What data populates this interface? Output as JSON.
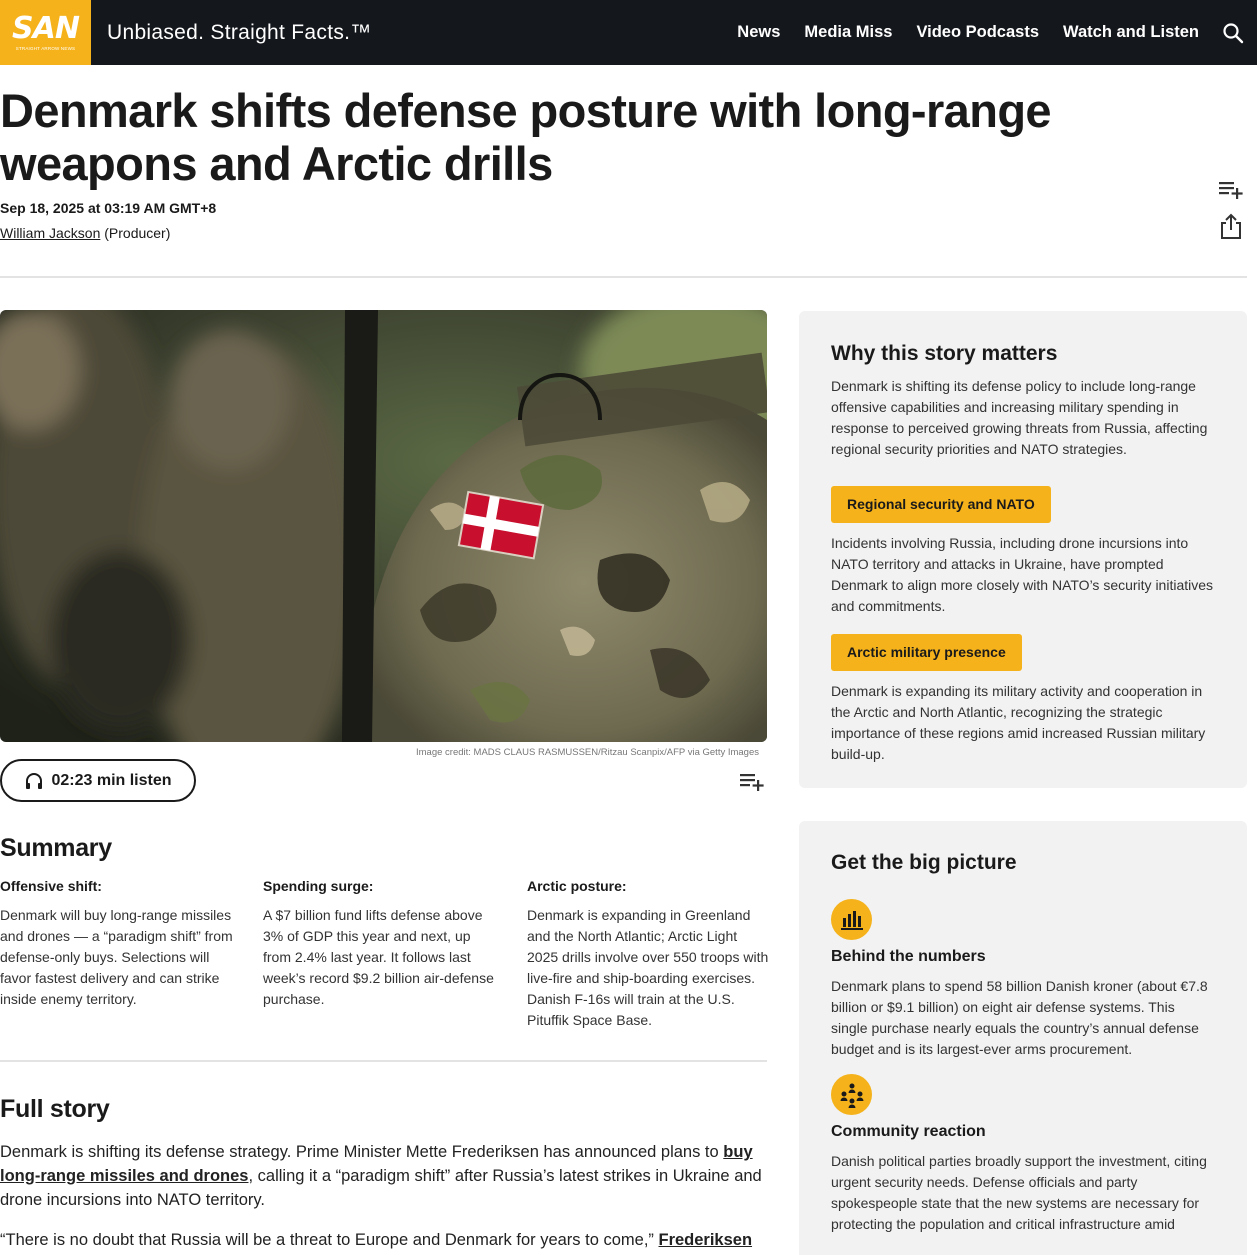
{
  "header": {
    "logo_text": "SAN",
    "logo_subtext": "STRAIGHT ARROW NEWS",
    "tagline": "Unbiased. Straight Facts.™",
    "nav": [
      "News",
      "Media Miss",
      "Video Podcasts",
      "Watch and Listen"
    ],
    "brand_color": "#f5b21a"
  },
  "article": {
    "headline": "Denmark shifts defense posture with long-range weapons and Arctic drills",
    "date": "Sep 18, 2025 at 03:19 AM GMT+8",
    "author": "William Jackson",
    "author_role": "(Producer)",
    "image_credit": "Image credit: MADS CLAUS RASMUSSEN/Ritzau Scanpix/AFP via Getty Images",
    "listen_label": "02:23 min listen"
  },
  "summary": {
    "heading": "Summary",
    "items": [
      {
        "title": "Offensive shift:",
        "text": "Denmark will buy long-range missiles and drones — a “paradigm shift” from defense-only buys. Selections will favor fastest delivery and can strike inside enemy territory."
      },
      {
        "title": "Spending surge:",
        "text": "A $7 billion fund lifts defense above 3% of GDP this year and next, up from 2.4% last year. It follows last week’s record $9.2 billion air-defense purchase."
      },
      {
        "title": "Arctic posture:",
        "text": "Denmark is expanding in Greenland and the North Atlantic; Arctic Light 2025 drills involve over 550 troops with live-fire and ship-boarding exercises. Danish F-16s will train at the U.S. Pituffik Space Base."
      }
    ]
  },
  "full_story": {
    "heading": "Full story",
    "p1_pre": "Denmark is shifting its defense strategy. Prime Minister Mette Frederiksen has announced plans to ",
    "p1_link": "buy long-range missiles and drones",
    "p1_post": ", calling it a “paradigm shift” after Russia’s latest strikes in Ukraine and drone incursions into NATO territory.",
    "p2_pre": "“There is no doubt that Russia will be a threat to Europe and Denmark for years to come,” ",
    "p2_link": "Frederiksen told"
  },
  "why_matters": {
    "title": "Why this story matters",
    "text": "Denmark is shifting its defense policy to include long-range offensive capabilities and increasing military spending in response to perceived growing threats from Russia, affecting regional security priorities and NATO strategies.",
    "topics": [
      {
        "label": "Regional security and NATO",
        "text": "Incidents involving Russia, including drone incursions into NATO territory and attacks in Ukraine, have prompted Denmark to align more closely with NATO’s security initiatives and commitments."
      },
      {
        "label": "Arctic military presence",
        "text": "Denmark is expanding its military activity and cooperation in the Arctic and North Atlantic, recognizing the strategic importance of these regions amid increased Russian military build-up."
      }
    ]
  },
  "big_picture": {
    "title": "Get the big picture",
    "items": [
      {
        "icon": "bar-chart-icon",
        "title": "Behind the numbers",
        "text": "Denmark plans to spend 58 billion Danish kroner (about €7.8 billion or $9.1 billion) on eight air defense systems. This single purchase nearly equals the country’s annual defense budget and is its largest-ever arms procurement."
      },
      {
        "icon": "community-icon",
        "title": "Community reaction",
        "text": "Danish political parties broadly support the investment, citing urgent security needs. Defense officials and party spokespeople state that the new systems are necessary for protecting the population and critical infrastructure amid"
      }
    ]
  }
}
